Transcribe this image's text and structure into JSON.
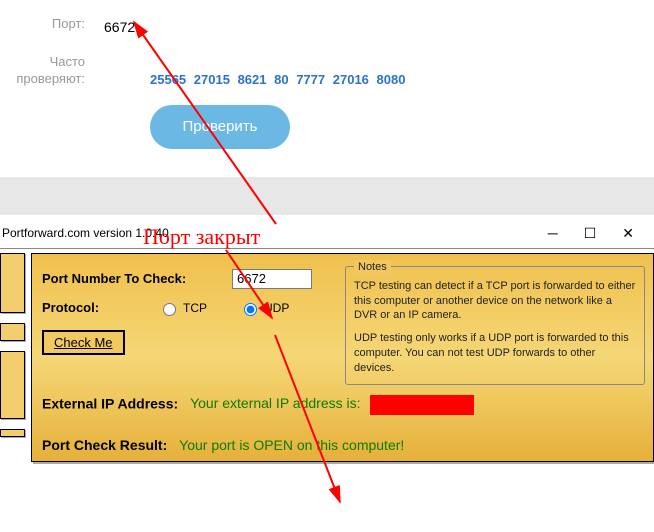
{
  "top": {
    "port_label": "Порт:",
    "port_value": "6672",
    "freq_label": "Часто\nпроверяют:",
    "freq_ports": [
      "25565",
      "27015",
      "8621",
      "80",
      "7777",
      "27016",
      "8080"
    ],
    "check_btn": "Проверить"
  },
  "annotation": {
    "closed": "Порт закрыт"
  },
  "window": {
    "title": "Portforward.com version 1.0.40"
  },
  "pf": {
    "port_label": "Port Number To Check:",
    "port_value": "6672",
    "protocol_label": "Protocol:",
    "proto_tcp": "TCP",
    "proto_udp": "UDP",
    "check_me": "Check Me",
    "notes_legend": "Notes",
    "notes_p1": "TCP testing can detect if a TCP port is forwarded to either this computer or another device on the network like a DVR or an IP camera.",
    "notes_p2": "UDP testing only works if a UDP port is forwarded to this computer. You can not test UDP forwards to other devices.",
    "ext_label": "External IP Address:",
    "ext_value": "Your external IP address is:",
    "result_label": "Port Check Result:",
    "result_value": "Your port is OPEN on this computer!"
  }
}
